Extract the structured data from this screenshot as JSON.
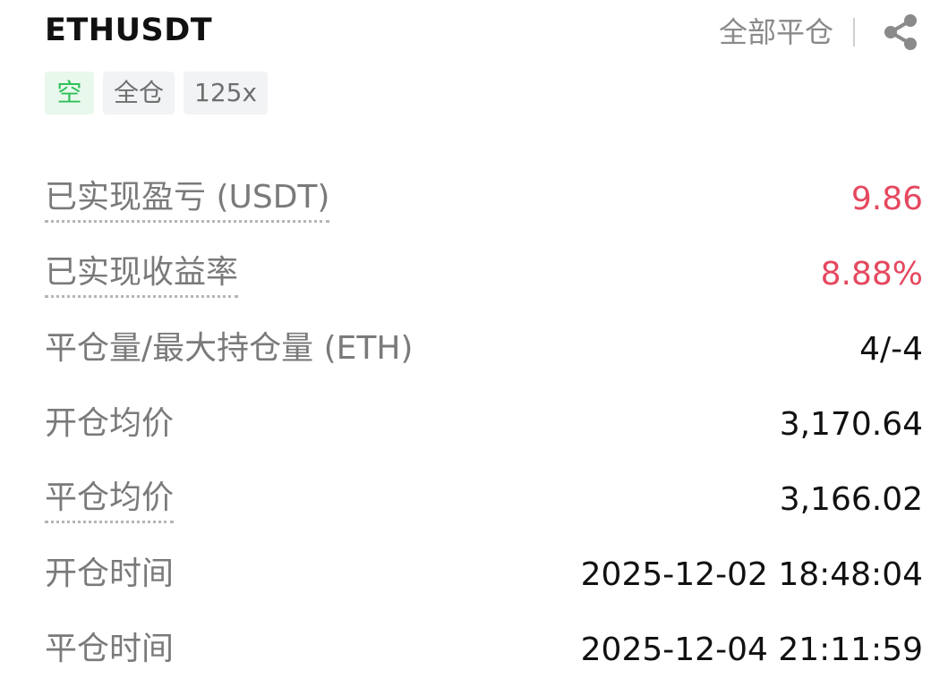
{
  "header": {
    "symbol": "ETHUSDT",
    "close_all_label": "全部平仓",
    "share_icon": "share-icon"
  },
  "tags": {
    "side": "空",
    "margin_mode": "全仓",
    "leverage": "125x"
  },
  "details": {
    "realized_pnl": {
      "label": "已实现盈亏 (USDT)",
      "value": "9.86"
    },
    "realized_roi": {
      "label": "已实现收益率",
      "value": "8.88%"
    },
    "close_max_qty": {
      "label": "平仓量/最大持仓量 (ETH)",
      "value": "4/-4"
    },
    "open_avg_price": {
      "label": "开仓均价",
      "value": "3,170.64"
    },
    "close_avg_price": {
      "label": "平仓均价",
      "value": "3,166.02"
    },
    "open_time": {
      "label": "开仓时间",
      "value": "2025-12-02 18:48:04"
    },
    "close_time": {
      "label": "平仓时间",
      "value": "2025-12-04 21:11:59"
    }
  },
  "colors": {
    "profit": "#e5485f",
    "short_tag_text": "#2fbf5a",
    "short_tag_bg": "#e8f8ec",
    "label_text": "#7a7a7a",
    "value_text": "#111111"
  }
}
